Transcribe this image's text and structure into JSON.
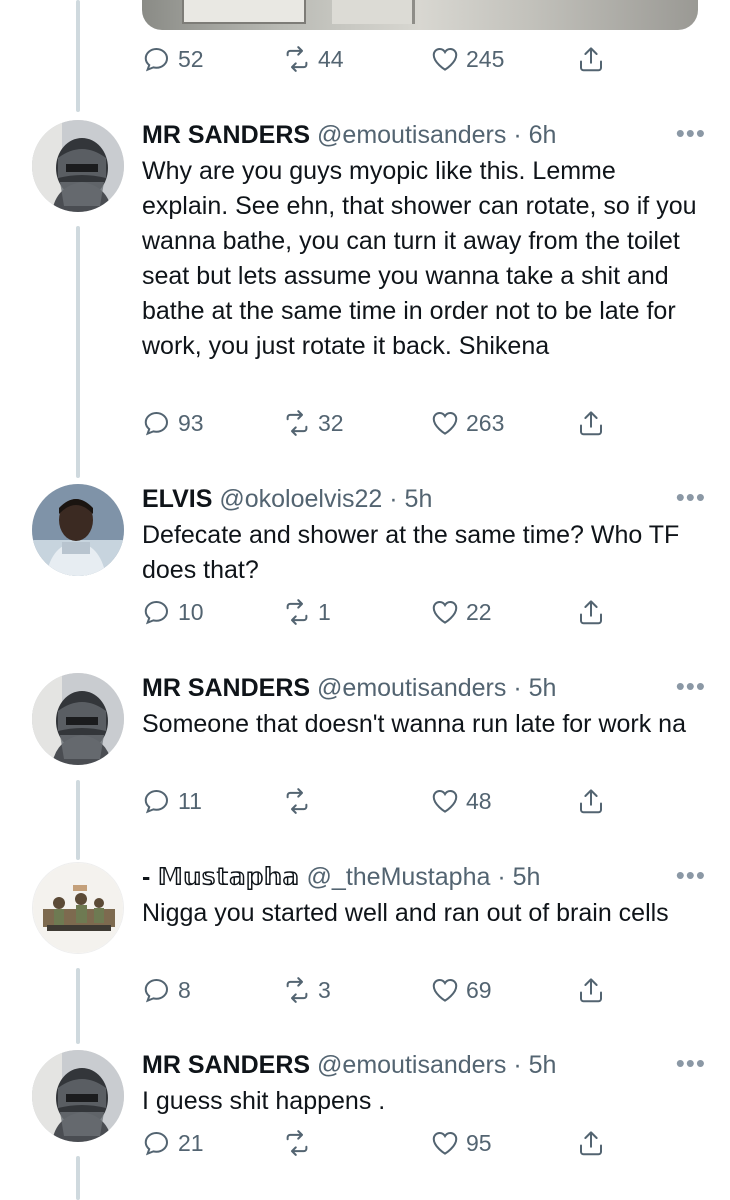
{
  "top_actions": {
    "replies": "52",
    "retweets": "44",
    "likes": "245"
  },
  "tweets": [
    {
      "name": "MR SANDERS",
      "handle": "@emoutisanders",
      "time": "· 6h",
      "text": "Why are you guys myopic like this. Lemme explain. See ehn, that shower can rotate, so if you wanna bathe, you can turn it away from the toilet seat but lets assume you wanna take a shit and bathe at the same time in order not to be late for work, you just rotate it back. Shikena",
      "replies": "93",
      "retweets": "32",
      "likes": "263",
      "avatar": "masked-man-avatar"
    },
    {
      "name": "ELVIS",
      "handle": "@okoloelvis22",
      "time": "· 5h",
      "text": "Defecate and shower at the same time? Who TF does that?",
      "replies": "10",
      "retweets": "1",
      "likes": "22",
      "avatar": "man-avatar"
    },
    {
      "name": "MR SANDERS",
      "handle": "@emoutisanders",
      "time": "· 5h",
      "text": "Someone that doesn't wanna run late for work na",
      "replies": "11",
      "retweets": "",
      "likes": "48",
      "avatar": "masked-man-avatar"
    },
    {
      "name": "- 𝕄𝕦𝕤𝕥𝕒𝕡𝕙𝕒",
      "handle": "@_theMustapha",
      "time": "· 5h",
      "text": "Nigga you started well and ran out of brain cells",
      "replies": "8",
      "retweets": "3",
      "likes": "69",
      "avatar": "soldiers-avatar"
    },
    {
      "name": "MR SANDERS",
      "handle": "@emoutisanders",
      "time": "· 5h",
      "text": "I guess shit happens .",
      "replies": "21",
      "retweets": "",
      "likes": "95",
      "avatar": "masked-man-avatar"
    }
  ],
  "more_label": "•••"
}
